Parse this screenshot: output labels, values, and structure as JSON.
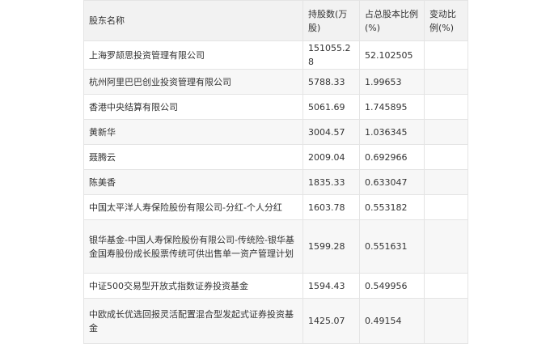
{
  "table": {
    "headers": [
      "股东名称",
      "持股数(万股)",
      "占总股本比例(%)",
      "变动比例(%)"
    ],
    "rows": [
      {
        "name": "上海罗颉思投资管理有限公司",
        "shares": "151055.28",
        "ratio": "52.102505",
        "change": ""
      },
      {
        "name": "杭州阿里巴巴创业投资管理有限公司",
        "shares": "5788.33",
        "ratio": "1.99653",
        "change": ""
      },
      {
        "name": "香港中央结算有限公司",
        "shares": "5061.69",
        "ratio": "1.745895",
        "change": ""
      },
      {
        "name": "黄新华",
        "shares": "3004.57",
        "ratio": "1.036345",
        "change": ""
      },
      {
        "name": "聂腾云",
        "shares": "2009.04",
        "ratio": "0.692966",
        "change": ""
      },
      {
        "name": "陈美香",
        "shares": "1835.33",
        "ratio": "0.633047",
        "change": ""
      },
      {
        "name": "中国太平洋人寿保险股份有限公司-分红-个人分红",
        "shares": "1603.78",
        "ratio": "0.553182",
        "change": ""
      },
      {
        "name": "银华基金-中国人寿保险股份有限公司-传统险-银华基金国寿股份成长股票传统可供出售单一资产管理计划",
        "shares": "1599.28",
        "ratio": "0.551631",
        "change": ""
      },
      {
        "name": "中证500交易型开放式指数证券投资基金",
        "shares": "1594.43",
        "ratio": "0.549956",
        "change": ""
      },
      {
        "name": "中欧成长优选回报灵活配置混合型发起式证券投资基金",
        "shares": "1425.07",
        "ratio": "0.49154",
        "change": ""
      }
    ]
  }
}
